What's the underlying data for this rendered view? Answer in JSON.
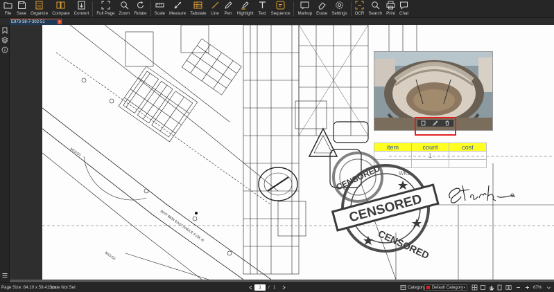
{
  "toolbar": {
    "items": [
      {
        "id": "file",
        "label": "File",
        "icon": "folder-icon"
      },
      {
        "id": "save",
        "label": "Save",
        "icon": "save-icon"
      },
      {
        "id": "organize",
        "label": "Organize",
        "icon": "organize-icon"
      },
      {
        "id": "compare",
        "label": "Compare",
        "icon": "compare-icon"
      },
      {
        "id": "convert",
        "label": "Convert",
        "icon": "convert-icon"
      },
      {
        "id": "fullpage",
        "label": "Full Page",
        "icon": "fullpage-icon"
      },
      {
        "id": "zoom",
        "label": "Zoom",
        "icon": "zoom-icon"
      },
      {
        "id": "rotate",
        "label": "Rotate",
        "icon": "rotate-icon"
      },
      {
        "id": "scale",
        "label": "Scale",
        "icon": "scale-icon"
      },
      {
        "id": "measure",
        "label": "Measure",
        "icon": "measure-icon"
      },
      {
        "id": "tabulate",
        "label": "Tabulate",
        "icon": "tabulate-icon"
      },
      {
        "id": "line",
        "label": "Line",
        "icon": "line-icon"
      },
      {
        "id": "pen",
        "label": "Pen",
        "icon": "pen-icon"
      },
      {
        "id": "highlight",
        "label": "Highlight",
        "icon": "highlight-icon"
      },
      {
        "id": "text",
        "label": "Text",
        "icon": "text-icon"
      },
      {
        "id": "sequence",
        "label": "Sequence",
        "icon": "sequence-icon"
      },
      {
        "id": "markup",
        "label": "Markup",
        "icon": "markup-icon"
      },
      {
        "id": "erase",
        "label": "Erase",
        "icon": "erase-icon"
      },
      {
        "id": "settings",
        "label": "Settings",
        "icon": "gear-icon"
      },
      {
        "id": "ocr",
        "label": "OCR",
        "icon": "ocr-icon"
      },
      {
        "id": "search",
        "label": "Search",
        "icon": "search-icon"
      },
      {
        "id": "print",
        "label": "Print",
        "icon": "print-icon"
      },
      {
        "id": "chat",
        "label": "Chat",
        "icon": "chat-icon"
      }
    ]
  },
  "tab": {
    "label": "E973-38-7-302-51",
    "close": "×"
  },
  "document": {
    "table": {
      "headers": [
        "item",
        "count",
        "cost"
      ],
      "rows": [
        [
          "",
          "1",
          ""
        ],
        [
          "",
          "",
          ""
        ]
      ]
    },
    "stamp_text": "CENSORED",
    "signature_text": "Stark",
    "plan_text": "WKL",
    "plan_label_a": "M15-D1",
    "plan_label_b": "BHIT 8836 EAST ANGLE 4 (3K 4)"
  },
  "statusbar": {
    "page_size": "Page Size: 84.10 x 59.41 cm",
    "scale": "Scale Not Set",
    "current_page": "1",
    "page_sep": "/",
    "total_pages": "1",
    "category_label": "Category",
    "category_value": "Default Category",
    "category_color": "#e02020",
    "zoom": "67%"
  },
  "colors": {
    "accent": "#d45a2a",
    "highlight_header": "#ffff22",
    "selection": "#e02020"
  }
}
